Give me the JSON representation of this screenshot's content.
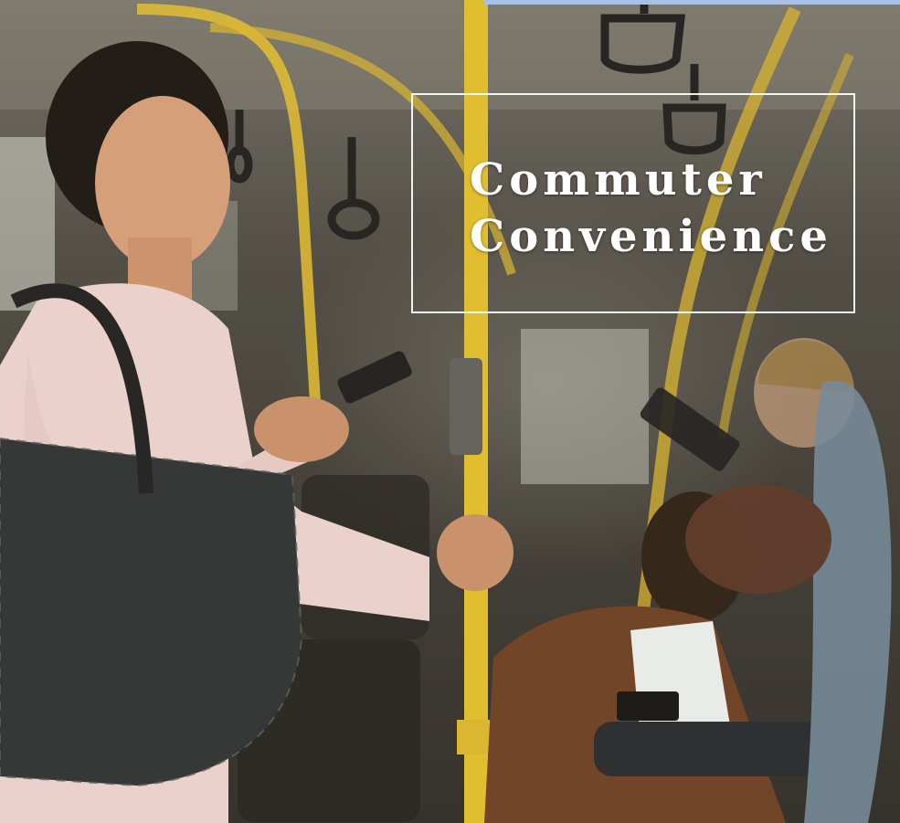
{
  "hero": {
    "title_line_1": "Commuter",
    "title_line_2": "Convenience"
  },
  "colors": {
    "title_text": "#ffffff",
    "box_border": "#ffffff",
    "pole_yellow": "#e3bd2c",
    "top_strip": "#a9c2e3"
  },
  "icons": [
    "phone-icon",
    "handle-icon"
  ]
}
